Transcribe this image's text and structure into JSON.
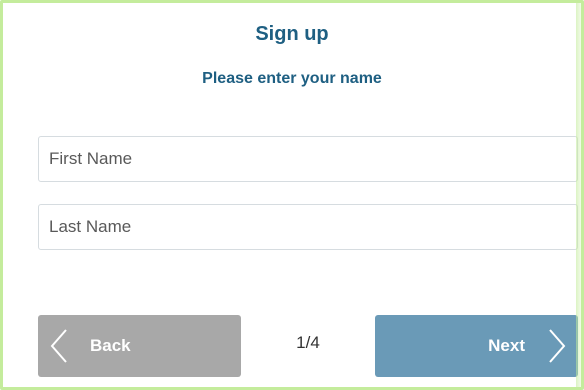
{
  "header": {
    "title": "Sign up",
    "subtitle": "Please enter your name"
  },
  "form": {
    "first_name": {
      "placeholder": "First Name",
      "value": ""
    },
    "last_name": {
      "placeholder": "Last Name",
      "value": ""
    }
  },
  "footer": {
    "back_label": "Back",
    "next_label": "Next",
    "page_indicator": "1/4",
    "back_icon": "chevron-left-icon",
    "next_icon": "chevron-right-icon"
  },
  "colors": {
    "heading": "#1e5f82",
    "back_button": "#a8a8a8",
    "next_button": "#6a9ab7",
    "frame_border": "#c4ec9c"
  }
}
